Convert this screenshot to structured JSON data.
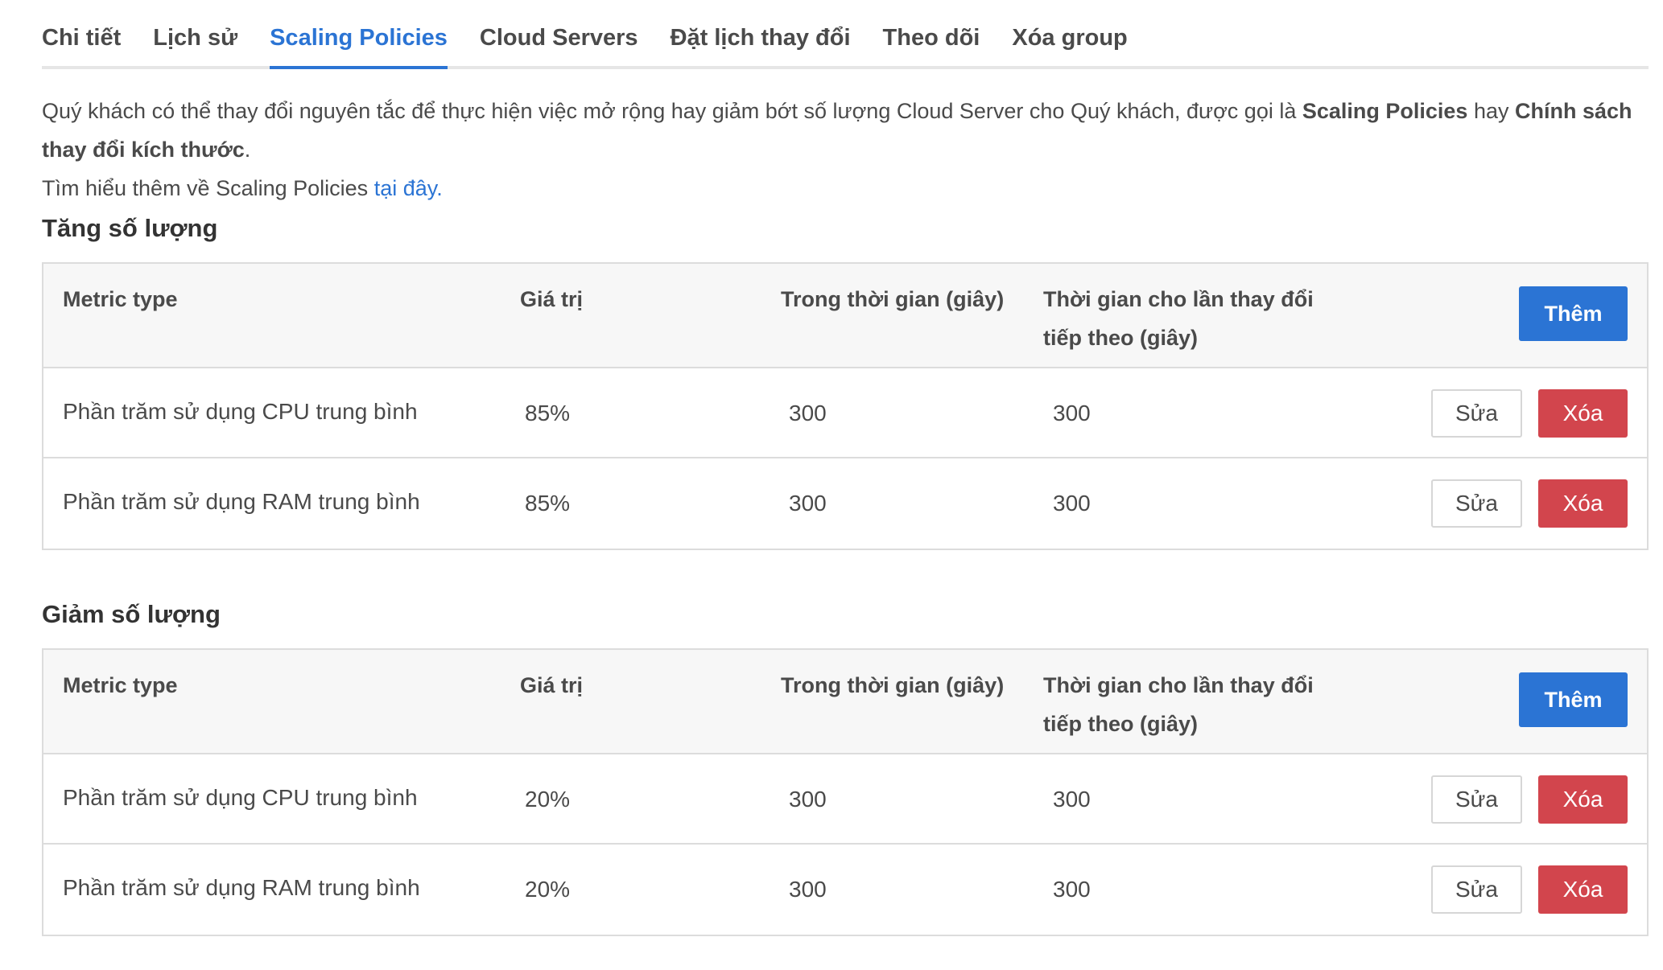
{
  "tabs": [
    {
      "label": "Chi tiết",
      "active": false
    },
    {
      "label": "Lịch sử",
      "active": false
    },
    {
      "label": "Scaling Policies",
      "active": true
    },
    {
      "label": "Cloud Servers",
      "active": false
    },
    {
      "label": "Đặt lịch thay đổi",
      "active": false
    },
    {
      "label": "Theo dõi",
      "active": false
    },
    {
      "label": "Xóa group",
      "active": false
    }
  ],
  "intro": {
    "text_1": "Quý khách có thể thay đổi nguyên tắc để thực hiện việc mở rộng hay giảm bớt số lượng Cloud Server cho Quý khách, được gọi là ",
    "bold_1": "Scaling Policies",
    "text_2": " hay ",
    "bold_2": "Chính sách thay đổi kích thước",
    "text_3": ".",
    "learn_more": "Tìm hiểu thêm về Scaling Policies ",
    "link": "tại đây."
  },
  "columns": {
    "metric": "Metric type",
    "value": "Giá trị",
    "duration": "Trong thời gian (giây)",
    "cooldown": "Thời gian cho lần thay đổi tiếp theo (giây)"
  },
  "buttons": {
    "add": "Thêm",
    "edit": "Sửa",
    "delete": "Xóa"
  },
  "increase": {
    "title": "Tăng số lượng",
    "rows": [
      {
        "metric": "Phần trăm sử dụng CPU trung bình",
        "value": "85%",
        "duration": "300",
        "cooldown": "300"
      },
      {
        "metric": "Phần trăm sử dụng RAM trung bình",
        "value": "85%",
        "duration": "300",
        "cooldown": "300"
      }
    ]
  },
  "decrease": {
    "title": "Giảm số lượng",
    "rows": [
      {
        "metric": "Phần trăm sử dụng CPU trung bình",
        "value": "20%",
        "duration": "300",
        "cooldown": "300"
      },
      {
        "metric": "Phần trăm sử dụng RAM trung bình",
        "value": "20%",
        "duration": "300",
        "cooldown": "300"
      }
    ]
  },
  "colors": {
    "accent": "#2b74d4",
    "danger": "#d2454d",
    "text": "#4a4a4a"
  }
}
